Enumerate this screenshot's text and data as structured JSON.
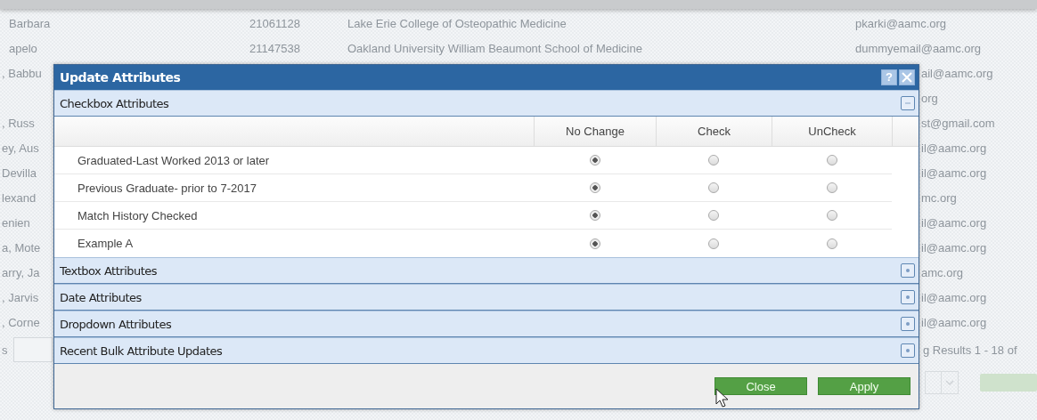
{
  "background": {
    "rows": [
      {
        "kind": "full",
        "name": "Barbara",
        "id": "21061128",
        "school": "Lake Erie College of Osteopathic Medicine",
        "email": "pkarki@aamc.org"
      },
      {
        "kind": "full",
        "name": "apelo",
        "id": "21147538",
        "school": "Oakland University William Beaumont School of Medicine",
        "email": "dummyemail@aamc.org"
      },
      {
        "kind": "partial",
        "name": ", Babbu",
        "email": "ail@aamc.org"
      },
      {
        "kind": "partial",
        "email": "org"
      },
      {
        "kind": "partial",
        "name": ", Russ",
        "email": "st@gmail.com"
      },
      {
        "kind": "partial",
        "name": "ey, Aus",
        "email": "il@aamc.org"
      },
      {
        "kind": "partial",
        "name": "Devilla",
        "email": "il@aamc.org"
      },
      {
        "kind": "partial",
        "name": "lexand",
        "email": "mc.org"
      },
      {
        "kind": "partial",
        "name": "enien",
        "email": "il@aamc.org"
      },
      {
        "kind": "partial",
        "name": "a, Mote",
        "email": "il@aamc.org"
      },
      {
        "kind": "partial",
        "name": "arry, Ja",
        "email": "amc.org"
      },
      {
        "kind": "partial",
        "name": ", Jarvis",
        "email": "il@aamc.org"
      },
      {
        "kind": "partial",
        "name": ", Corne",
        "email": "il@aamc.org"
      }
    ],
    "pager_label": "s",
    "results_text": "g Results 1 - 18 of"
  },
  "dialog": {
    "title": "Update Attributes",
    "help": "?",
    "sections": [
      {
        "title": "Checkbox Attributes",
        "expanded": true,
        "columns": [
          "No Change",
          "Check",
          "UnCheck"
        ],
        "rows": [
          {
            "label": "Graduated-Last Worked 2013 or later",
            "options": [
              {
                "selected": true
              },
              {
                "selected": false
              },
              {
                "selected": false
              }
            ]
          },
          {
            "label": "Previous Graduate- prior to 7-2017",
            "options": [
              {
                "selected": true
              },
              {
                "selected": false
              },
              {
                "selected": false
              }
            ]
          },
          {
            "label": "Match History Checked",
            "options": [
              {
                "selected": true
              },
              {
                "selected": false
              },
              {
                "selected": false
              }
            ]
          },
          {
            "label": "Example A",
            "options": [
              {
                "selected": true
              },
              {
                "selected": false
              },
              {
                "selected": false
              }
            ]
          }
        ]
      },
      {
        "title": "Textbox Attributes",
        "expanded": false
      },
      {
        "title": "Date Attributes",
        "expanded": false
      },
      {
        "title": "Dropdown Attributes",
        "expanded": false
      },
      {
        "title": "Recent Bulk Attribute Updates",
        "expanded": false
      }
    ],
    "buttons": [
      "Close",
      "Apply"
    ]
  }
}
